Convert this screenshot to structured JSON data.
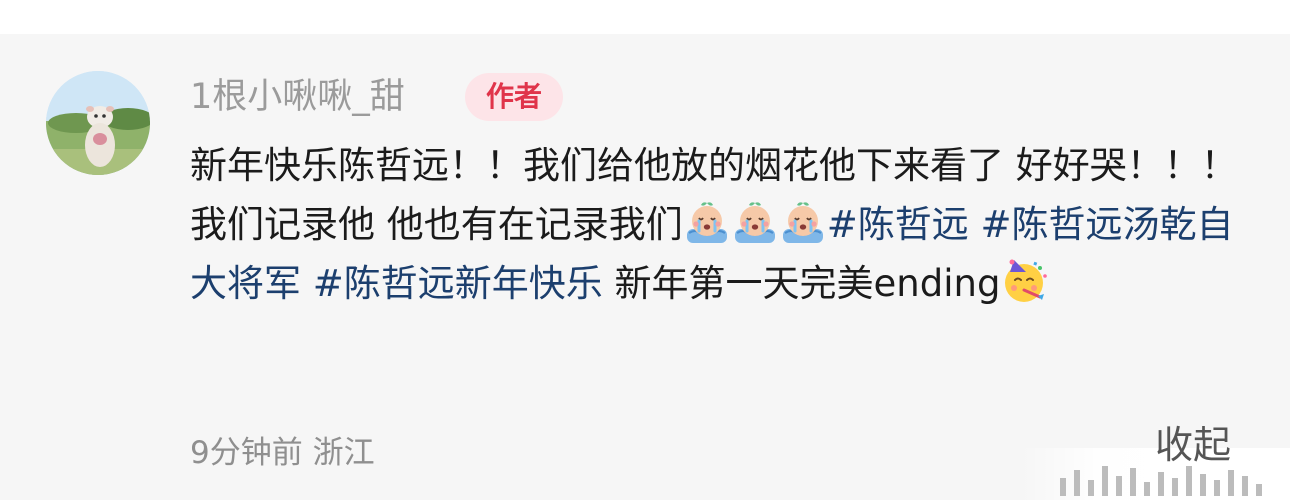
{
  "comment": {
    "author": {
      "name": "1根小啾啾_甜",
      "badge": "作者"
    },
    "segments": [
      {
        "type": "text",
        "text": "新年快乐陈哲远！！我们给他放的烟花他下来看了 好好哭！！！我们记录他 他也有在记录我们"
      },
      {
        "type": "emoji",
        "icon": "crying-baby-emoji"
      },
      {
        "type": "emoji",
        "icon": "crying-baby-emoji"
      },
      {
        "type": "emoji",
        "icon": "crying-baby-emoji"
      },
      {
        "type": "hashtag",
        "text": "#陈哲远"
      },
      {
        "type": "text",
        "text": " "
      },
      {
        "type": "hashtag",
        "text": "#陈哲远汤乾自大将军"
      },
      {
        "type": "text",
        "text": "  "
      },
      {
        "type": "hashtag",
        "text": "#陈哲远新年快乐"
      },
      {
        "type": "text",
        "text": "  新年第一天完美ending"
      },
      {
        "type": "emoji",
        "icon": "party-face-emoji"
      }
    ],
    "meta": "9分钟前 浙江",
    "collapse_label": "收起"
  },
  "colors": {
    "hashtag": "#1c3f6e",
    "badge_bg": "#fde4e8",
    "badge_text": "#e0344a",
    "card_bg": "#f6f6f6"
  }
}
